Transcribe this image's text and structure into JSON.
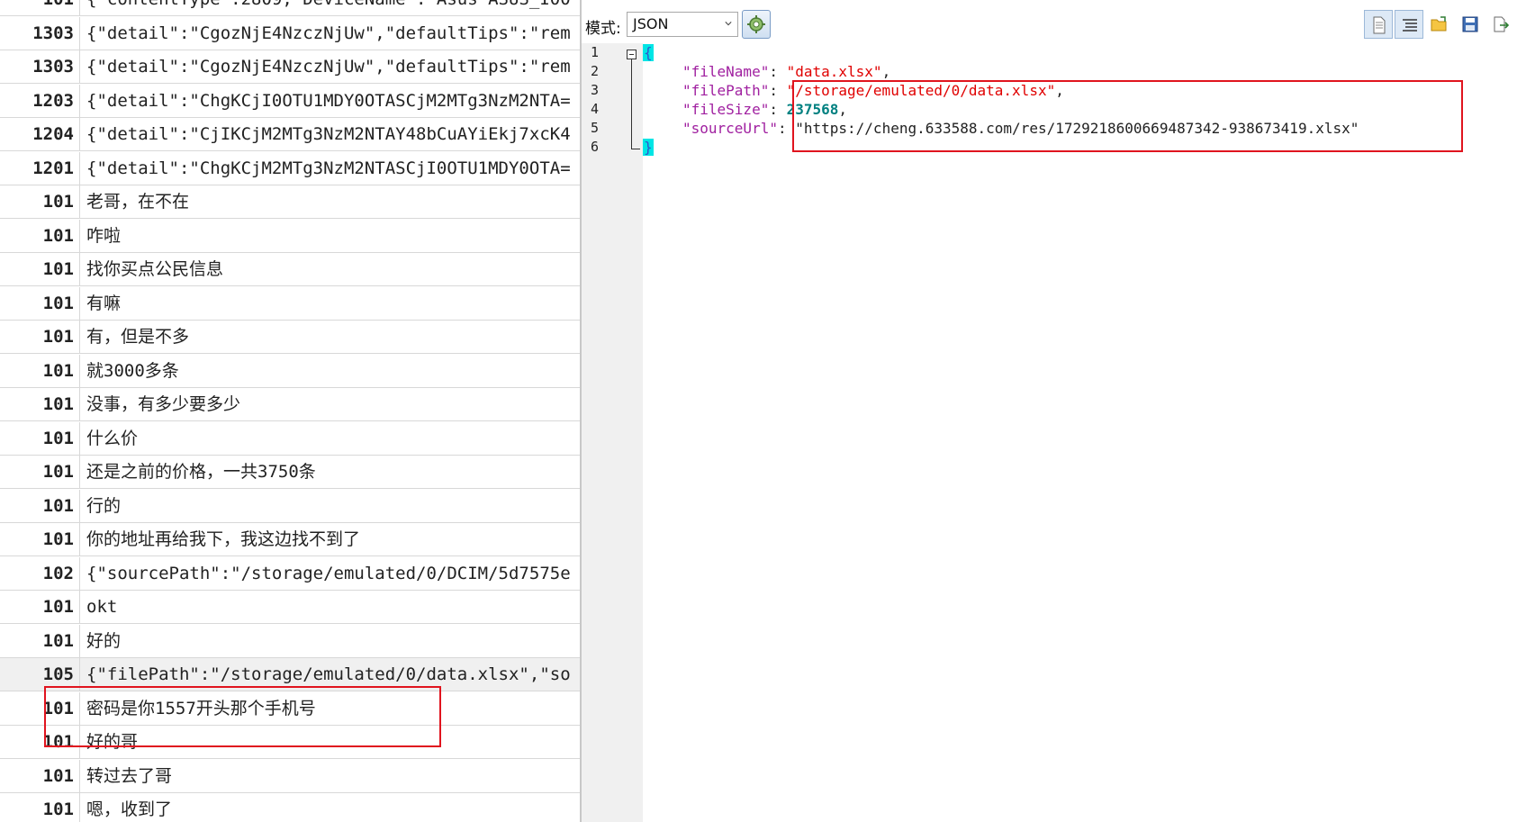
{
  "left_table": {
    "rows": [
      {
        "id": "101",
        "text": "{\"contentType\":2809,\"DeviceName\":\"Asus ASUS_I00"
      },
      {
        "id": "1303",
        "text": "{\"detail\":\"CgozNjE4NzczNjUw\",\"defaultTips\":\"rem"
      },
      {
        "id": "1303",
        "text": "{\"detail\":\"CgozNjE4NzczNjUw\",\"defaultTips\":\"rem"
      },
      {
        "id": "1203",
        "text": "{\"detail\":\"ChgKCjI0OTU1MDY0OTASCjM2MTg3NzM2NTA="
      },
      {
        "id": "1204",
        "text": "{\"detail\":\"CjIKCjM2MTg3NzM2NTAY48bCuAYiEkj7xcK4"
      },
      {
        "id": "1201",
        "text": "{\"detail\":\"ChgKCjM2MTg3NzM2NTASCjI0OTU1MDY0OTA="
      },
      {
        "id": "101",
        "text": "老哥，在不在"
      },
      {
        "id": "101",
        "text": "咋啦"
      },
      {
        "id": "101",
        "text": "找你买点公民信息"
      },
      {
        "id": "101",
        "text": "有嘛"
      },
      {
        "id": "101",
        "text": "有，但是不多"
      },
      {
        "id": "101",
        "text": "就3000多条"
      },
      {
        "id": "101",
        "text": "没事，有多少要多少"
      },
      {
        "id": "101",
        "text": "什么价"
      },
      {
        "id": "101",
        "text": "还是之前的价格，一共3750条"
      },
      {
        "id": "101",
        "text": "行的"
      },
      {
        "id": "101",
        "text": "你的地址再给我下，我这边找不到了"
      },
      {
        "id": "102",
        "text": "{\"sourcePath\":\"/storage/emulated/0/DCIM/5d7575e"
      },
      {
        "id": "101",
        "text": "okt"
      },
      {
        "id": "101",
        "text": "好的"
      },
      {
        "id": "105",
        "text": "{\"filePath\":\"/storage/emulated/0/data.xlsx\",\"so"
      },
      {
        "id": "101",
        "text": "密码是你1557开头那个手机号"
      },
      {
        "id": "101",
        "text": "好的哥"
      },
      {
        "id": "101",
        "text": "转过去了哥"
      },
      {
        "id": "101",
        "text": "嗯，收到了"
      }
    ]
  },
  "editor": {
    "mode_label": "模式:",
    "mode_value": "JSON",
    "line_numbers": [
      "1",
      "2",
      "3",
      "4",
      "5",
      "6"
    ],
    "open_brace": "{",
    "close_brace": "}",
    "json": {
      "fileName_key": "\"fileName\"",
      "fileName_value": "\"data.xlsx\"",
      "filePath_key": "\"filePath\"",
      "filePath_value": "\"/storage/emulated/0/data.xlsx\"",
      "fileSize_key": "\"fileSize\"",
      "fileSize_value": "237568",
      "sourceUrl_key": "\"sourceUrl\"",
      "sourceUrl_value": "\"https://cheng.633588.com/res/1729218600669487342-938673419.xlsx\""
    }
  },
  "colors": {
    "annotation_red": "#e0141e",
    "json_key": "#a020a0",
    "json_string": "#e00000",
    "json_number": "#008080",
    "brace_highlight": "#00e5e5"
  },
  "icons": [
    "chevron-down-icon",
    "gear-icon",
    "document-icon",
    "list-view-icon",
    "open-folder-icon",
    "save-icon",
    "export-icon"
  ]
}
